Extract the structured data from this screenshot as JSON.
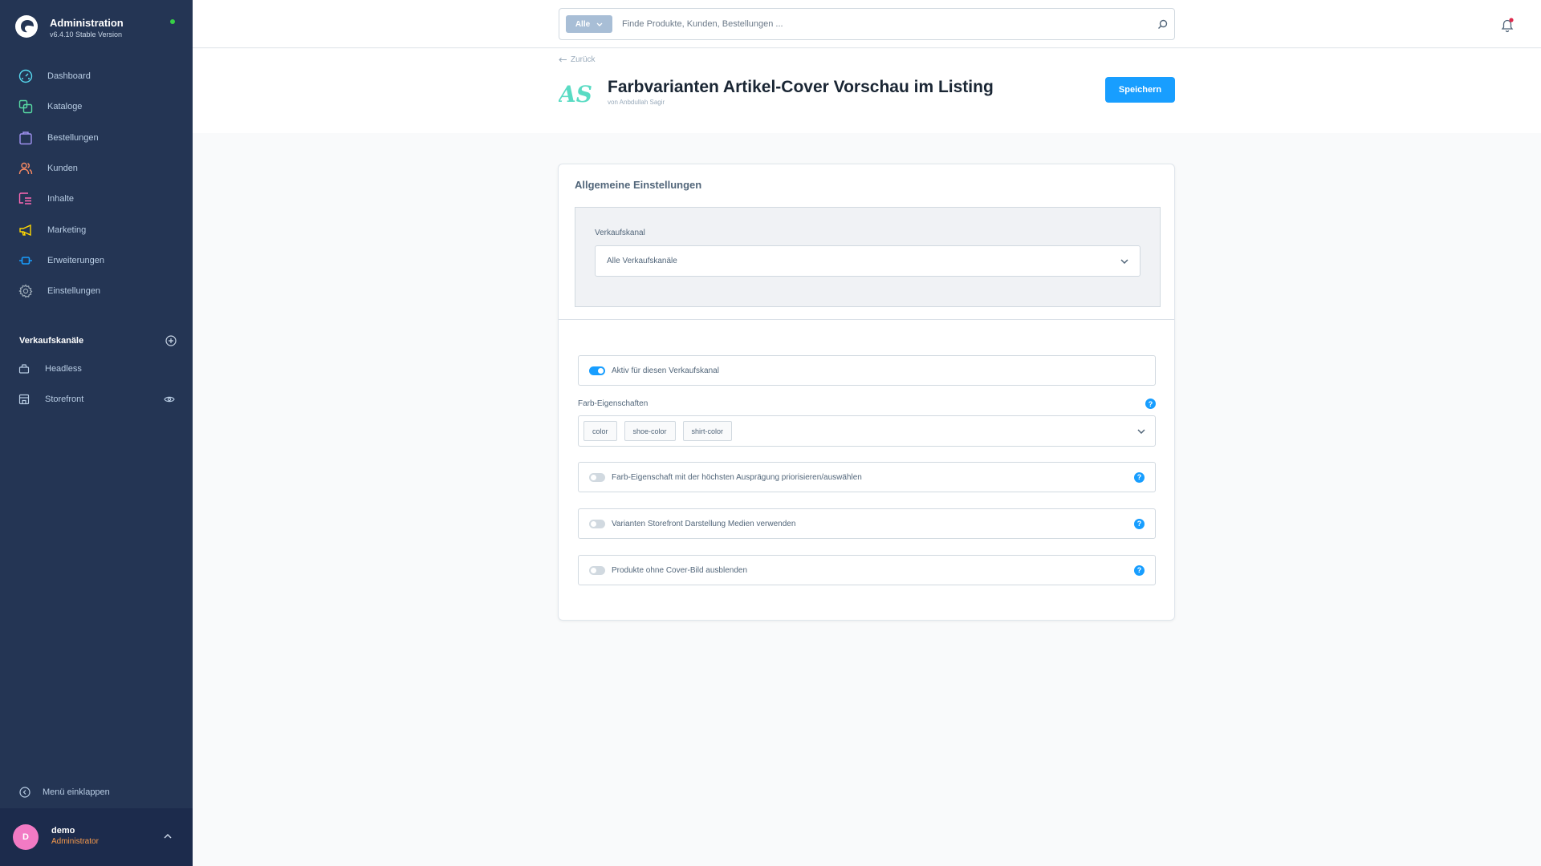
{
  "app": {
    "title": "Administration",
    "version": "v6.4.10 Stable Version",
    "status_color": "#37d046"
  },
  "sidebar": {
    "items": [
      {
        "label": "Dashboard",
        "icon": "dashboard-icon",
        "color": "#57d9f0"
      },
      {
        "label": "Kataloge",
        "icon": "catalog-icon",
        "color": "#57d9a3"
      },
      {
        "label": "Bestellungen",
        "icon": "shopping-bag-icon",
        "color": "#a092f0"
      },
      {
        "label": "Kunden",
        "icon": "customers-icon",
        "color": "#f88962"
      },
      {
        "label": "Inhalte",
        "icon": "content-icon",
        "color": "#ff68b4"
      },
      {
        "label": "Marketing",
        "icon": "megaphone-icon",
        "color": "#ffd700"
      },
      {
        "label": "Erweiterungen",
        "icon": "plug-icon",
        "color": "#189eff"
      },
      {
        "label": "Einstellungen",
        "icon": "gear-icon",
        "color": "#9aa8b5"
      }
    ],
    "channels_heading": "Verkaufskanäle",
    "channels": [
      {
        "label": "Headless",
        "icon": "basket-icon"
      },
      {
        "label": "Storefront",
        "icon": "storefront-icon",
        "action_icon": "eye-icon"
      }
    ],
    "collapse_label": "Menü einklappen",
    "user": {
      "initial": "D",
      "name": "demo",
      "role": "Administrator"
    }
  },
  "topbar": {
    "search_type": "Alle",
    "search_placeholder": "Finde Produkte, Kunden, Bestellungen ..."
  },
  "page": {
    "back_label": "Zurück",
    "title": "Farbvarianten Artikel-Cover Vorschau im Listing",
    "author": "von Anbdullah Sagir",
    "logo_text": "AS",
    "save_label": "Speichern"
  },
  "card": {
    "title": "Allgemeine Einstellungen",
    "sales_channel_label": "Verkaufskanal",
    "sales_channel_value": "Alle Verkaufskanäle",
    "active_toggle": {
      "label": "Aktiv für diesen Verkaufskanal",
      "enabled": true
    },
    "color_properties_label": "Farb-Eigenschaften",
    "color_properties": [
      "color",
      "shoe-color",
      "shirt-color"
    ],
    "options": [
      {
        "label": "Farb-Eigenschaft mit der höchsten Ausprägung priorisieren/auswählen",
        "enabled": false
      },
      {
        "label": "Varianten Storefront Darstellung Medien verwenden",
        "enabled": false
      },
      {
        "label": "Produkte ohne Cover-Bild ausblenden",
        "enabled": false
      }
    ],
    "help_glyph": "?"
  },
  "colors": {
    "accent": "#189eff",
    "sidebar_bg": "#243554",
    "user_area_bg": "#1c2b4c",
    "role_color": "#f79a4b",
    "avatar_bg": "#f27ac4",
    "notification_dot": "#de294c"
  }
}
